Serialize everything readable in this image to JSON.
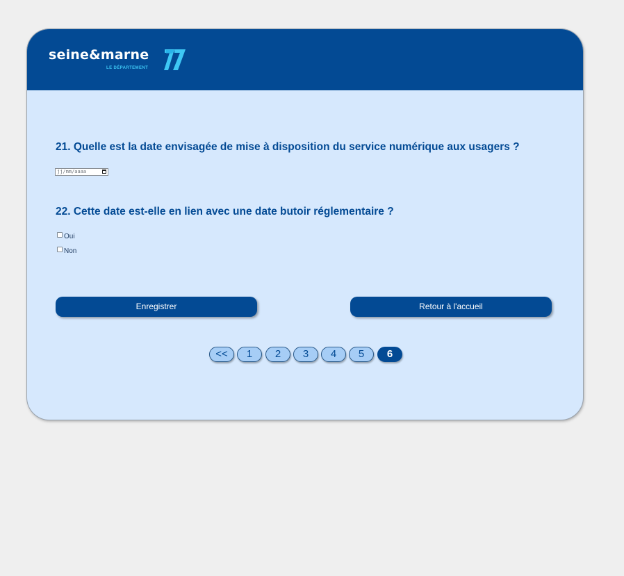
{
  "header": {
    "logo_text": "seine&marne",
    "logo_subtitle": "LE DÉPARTEMENT",
    "logo_number": "77"
  },
  "form": {
    "q21": {
      "label": "21. Quelle est la date envisagée de mise à disposition du service numérique aux usagers ?",
      "date_placeholder": "jj/mm/aaaa"
    },
    "q22": {
      "label": "22. Cette date est-elle en lien avec une date butoir réglementaire ?",
      "options": [
        {
          "label": "Oui",
          "checked": false
        },
        {
          "label": "Non",
          "checked": false
        }
      ]
    }
  },
  "actions": {
    "save_label": "Enregistrer",
    "home_label": "Retour à l'accueil"
  },
  "pagination": {
    "prev_label": "<<",
    "pages": [
      "1",
      "2",
      "3",
      "4",
      "5",
      "6"
    ],
    "current": "6"
  },
  "colors": {
    "brand_blue": "#034a94",
    "panel_bg": "#d6e8fd",
    "accent_cyan": "#3ec7f4",
    "page_pill": "#a6cdf6"
  }
}
